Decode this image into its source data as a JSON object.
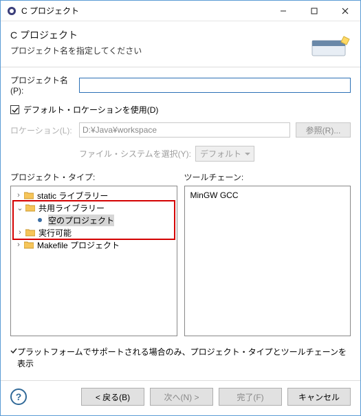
{
  "titlebar": {
    "title": "C プロジェクト"
  },
  "header": {
    "title": "C プロジェクト",
    "subtitle": "プロジェクト名を指定してください"
  },
  "form": {
    "projectname_label": "プロジェクト名(P):",
    "projectname_value": "",
    "default_location_checkbox": "デフォルト・ロケーションを使用(D)",
    "default_location_checked": true,
    "location_label": "ロケーション(L):",
    "location_value": "D:¥Java¥workspace",
    "browse_button": "参照(R)...",
    "filesystem_label": "ファイル・システムを選択(Y):",
    "filesystem_value": "デフォルト"
  },
  "columns": {
    "left_caption": "プロジェクト・タイプ:",
    "right_caption": "ツールチェーン:"
  },
  "tree": [
    {
      "level": 1,
      "expander": ">",
      "icon": "folder",
      "label": "static ライブラリー",
      "selected": false,
      "highlight": false
    },
    {
      "level": 1,
      "expander": "v",
      "icon": "folder",
      "label": "共用ライブラリー",
      "selected": false,
      "highlight": true
    },
    {
      "level": 2,
      "expander": "",
      "icon": "dot",
      "label": "空のプロジェクト",
      "selected": true,
      "highlight": true
    },
    {
      "level": 1,
      "expander": ">",
      "icon": "folder",
      "label": "実行可能",
      "selected": false,
      "highlight": true
    },
    {
      "level": 1,
      "expander": ">",
      "icon": "folder",
      "label": "Makefile プロジェクト",
      "selected": false,
      "highlight": false
    }
  ],
  "toolchains": [
    {
      "label": "MinGW GCC"
    }
  ],
  "platform_checkbox": {
    "label": "プラットフォームでサポートされる場合のみ、プロジェクト・タイプとツールチェーンを表示",
    "checked": true
  },
  "footer": {
    "back": "< 戻る(B)",
    "next": "次へ(N) >",
    "finish": "完了(F)",
    "cancel": "キャンセル"
  }
}
